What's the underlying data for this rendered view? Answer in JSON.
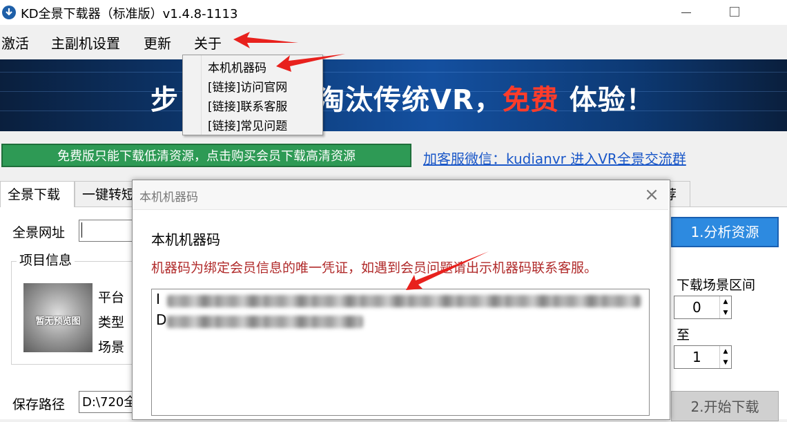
{
  "window": {
    "title": "KD全景下载器（标准版）v1.4.8-1113"
  },
  "menubar": {
    "items": [
      "激活",
      "主副机设置",
      "更新",
      "关于"
    ]
  },
  "dropdown": {
    "items": [
      "本机机器码",
      "[链接]访问官网",
      "[链接]联系客服",
      "[链接]常见问题"
    ]
  },
  "banner": {
    "text_left": "步",
    "text_mid": "淘汰传统VR，",
    "text_red": "免费",
    "text_right": " 体验！"
  },
  "notice": {
    "button": "免费版只能下载低清资源，点击购买会员下载高清资源",
    "wechat_link": "加客服微信：kudianvr 进入VR全景交流群"
  },
  "tabs": {
    "panorama": "全景下载",
    "second": "一键转短",
    "last": "荐"
  },
  "form": {
    "url_label": "全景网址",
    "project_title": "项目信息",
    "platform": "平台",
    "type": "类型",
    "scene": "场景",
    "preview_text": "暂无预览图",
    "save_label": "保存路径",
    "save_value": "D:\\720全"
  },
  "right": {
    "analyze": "1.分析资源",
    "range_label": "下载场景区间",
    "from_value": "0",
    "to_label": "至",
    "to_value": "1",
    "download": "2.开始下载"
  },
  "dialog": {
    "title": "本机机器码",
    "close": "×",
    "heading": "本机机器码",
    "note": "机器码为绑定会员信息的唯一凭证，如遇到会员问题请出示机器码联系客服。",
    "code_line1_prefix": "I",
    "code_line2_prefix": "D"
  },
  "colors": {
    "arrow": "#e8211d",
    "notice_green": "#2e9a55",
    "analyze_blue": "#2d8ae0",
    "link_blue": "#1a57c8",
    "note_red": "#b02a2a"
  }
}
